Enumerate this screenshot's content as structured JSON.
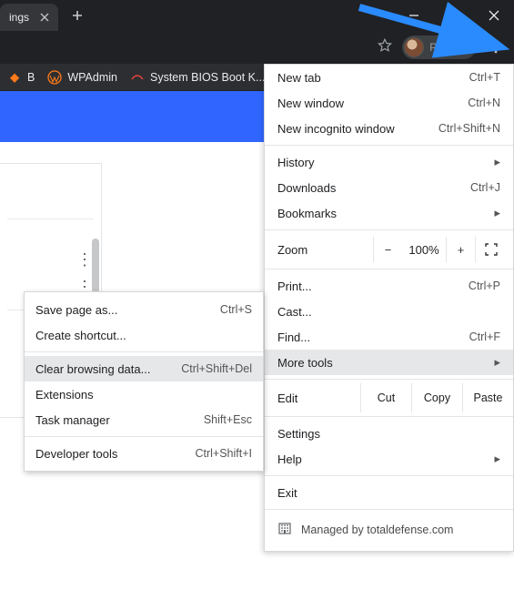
{
  "colors": {
    "arrow": "#2a8bff",
    "pageBlue": "#3066ff"
  },
  "tab": {
    "title": "ings"
  },
  "profile": {
    "status": "Paused"
  },
  "bookmarks": [
    {
      "label": "B",
      "iconColor": "#ff7a1a"
    },
    {
      "label": "WPAdmin",
      "iconType": "wp"
    },
    {
      "label": "System BIOS Boot K...",
      "iconType": "red"
    }
  ],
  "menu": {
    "new_tab": {
      "label": "New tab",
      "shortcut": "Ctrl+T"
    },
    "new_window": {
      "label": "New window",
      "shortcut": "Ctrl+N"
    },
    "new_incognito": {
      "label": "New incognito window",
      "shortcut": "Ctrl+Shift+N"
    },
    "history": {
      "label": "History"
    },
    "downloads": {
      "label": "Downloads",
      "shortcut": "Ctrl+J"
    },
    "bookmarks": {
      "label": "Bookmarks"
    },
    "zoom": {
      "label": "Zoom",
      "minus": "−",
      "pct": "100%",
      "plus": "+"
    },
    "print": {
      "label": "Print...",
      "shortcut": "Ctrl+P"
    },
    "cast": {
      "label": "Cast..."
    },
    "find": {
      "label": "Find...",
      "shortcut": "Ctrl+F"
    },
    "more_tools": {
      "label": "More tools"
    },
    "edit": {
      "label": "Edit",
      "cut": "Cut",
      "copy": "Copy",
      "paste": "Paste"
    },
    "settings": {
      "label": "Settings"
    },
    "help": {
      "label": "Help"
    },
    "exit": {
      "label": "Exit"
    },
    "managed": {
      "label": "Managed by totaldefense.com"
    }
  },
  "submenu": {
    "save_as": {
      "label": "Save page as...",
      "shortcut": "Ctrl+S"
    },
    "create_shortcut": {
      "label": "Create shortcut..."
    },
    "clear_data": {
      "label": "Clear browsing data...",
      "shortcut": "Ctrl+Shift+Del"
    },
    "extensions": {
      "label": "Extensions"
    },
    "task_manager": {
      "label": "Task manager",
      "shortcut": "Shift+Esc"
    },
    "dev_tools": {
      "label": "Developer tools",
      "shortcut": "Ctrl+Shift+I"
    }
  }
}
